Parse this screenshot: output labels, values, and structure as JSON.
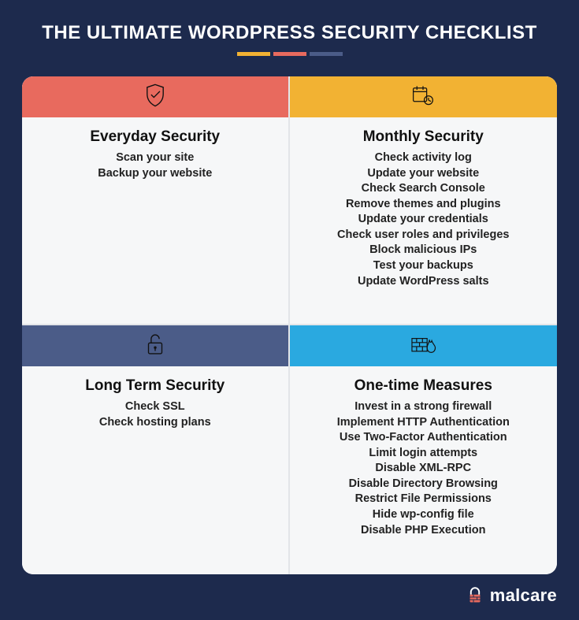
{
  "title": "THE ULTIMATE WORDPRESS SECURITY CHECKLIST",
  "accent_colors": {
    "gold": "#f2b233",
    "red": "#e86a5e",
    "slate": "#4b5c88",
    "cyan": "#2aa9e0"
  },
  "cards": [
    {
      "title": "Everyday Security",
      "items": [
        "Scan your site",
        "Backup your website"
      ]
    },
    {
      "title": "Monthly Security",
      "items": [
        "Check activity log",
        "Update your website",
        "Check Search Console",
        "Remove themes and plugins",
        "Update your credentials",
        "Check user roles and privileges",
        "Block malicious IPs",
        "Test your backups",
        "Update WordPress salts"
      ]
    },
    {
      "title": "Long Term Security",
      "items": [
        "Check SSL",
        "Check hosting plans"
      ]
    },
    {
      "title": "One-time Measures",
      "items": [
        "Invest in a strong firewall",
        "Implement HTTP Authentication",
        "Use Two-Factor Authentication",
        "Limit login attempts",
        "Disable XML-RPC",
        "Disable Directory Browsing",
        "Restrict File Permissions",
        "Hide wp-config file",
        "Disable PHP Execution"
      ]
    }
  ],
  "brand": "malcare"
}
